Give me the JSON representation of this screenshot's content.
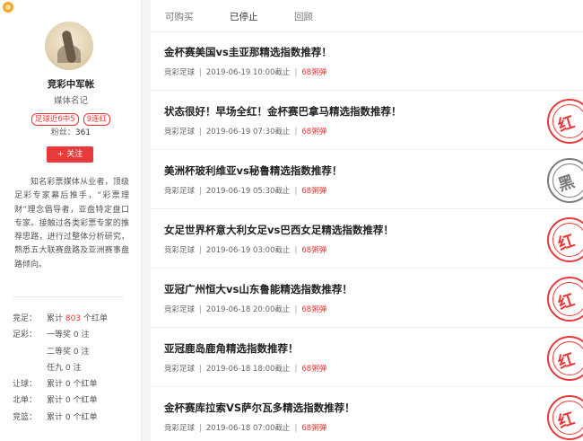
{
  "profile": {
    "name": "竞彩中军帐",
    "role": "媒体名记",
    "tags": [
      "足球近6中5",
      "9连红"
    ],
    "fans_label": "粉丝：",
    "fans": "361",
    "follow_label": "+ 关注",
    "description": "知名彩票媒体从业者，顶级足彩专家幕后推手，“彩票理财”理念倡导者，亚盘特定盘口专家。接触过各类彩票专家的推荐思路，进行过整体分析研究，熟悉五大联赛盘路及亚洲赛事盘路倾向。"
  },
  "stats": [
    {
      "k": "竞足：",
      "pre": "累计",
      "num": "803",
      "post": "个红单"
    },
    {
      "k": "足彩：",
      "pre": "一等奖",
      "num": "0",
      "post": "注"
    },
    {
      "k": "",
      "pre": "二等奖",
      "num": "0",
      "post": "注"
    },
    {
      "k": "",
      "pre": "任九",
      "num": "0",
      "post": "注"
    },
    {
      "k": "让球：",
      "pre": "累计",
      "num": "0",
      "post": "个红单"
    },
    {
      "k": "北单：",
      "pre": "累计",
      "num": "0",
      "post": "个红单"
    },
    {
      "k": "竞篮：",
      "pre": "累计",
      "num": "0",
      "post": "个红单"
    }
  ],
  "tabs": [
    "可购买",
    "已停止",
    "回顾"
  ],
  "active_tab": "已停止",
  "items": [
    {
      "title": "金杯赛美国vs圭亚那精选指数推荐！",
      "category": "竞彩足球",
      "time": "2019-06-19 10:00截止",
      "price": "68粥弹",
      "stamp": ""
    },
    {
      "title": "状态很好！早场全红！金杯赛巴拿马精选指数推荐！",
      "category": "竞彩足球",
      "time": "2019-06-19 07:30截止",
      "price": "68粥弹",
      "stamp": "红"
    },
    {
      "title": "美洲杯玻利维亚vs秘鲁精选指数推荐！",
      "category": "竞彩足球",
      "time": "2019-06-19 05:30截止",
      "price": "68粥弹",
      "stamp": "黑"
    },
    {
      "title": "女足世界杯意大利女足vs巴西女足精选指数推荐！",
      "category": "竞彩足球",
      "time": "2019-06-19 03:00截止",
      "price": "68粥弹",
      "stamp": "红"
    },
    {
      "title": "亚冠广州恒大vs山东鲁能精选指数推荐！",
      "category": "竞彩足球",
      "time": "2019-06-18 20:00截止",
      "price": "68粥弹",
      "stamp": "红"
    },
    {
      "title": "亚冠鹿岛鹿角精选指数推荐！",
      "category": "竞彩足球",
      "time": "2019-06-18 18:00截止",
      "price": "68粥弹",
      "stamp": "红"
    },
    {
      "title": "金杯赛库拉索VS萨尔瓦多精选指数推荐！",
      "category": "竞彩足球",
      "time": "2019-06-18 07:00截止",
      "price": "68粥弹",
      "stamp": "红"
    }
  ],
  "colors": {
    "accent": "#e83a3a",
    "black_stamp": "#7a7a7a"
  }
}
